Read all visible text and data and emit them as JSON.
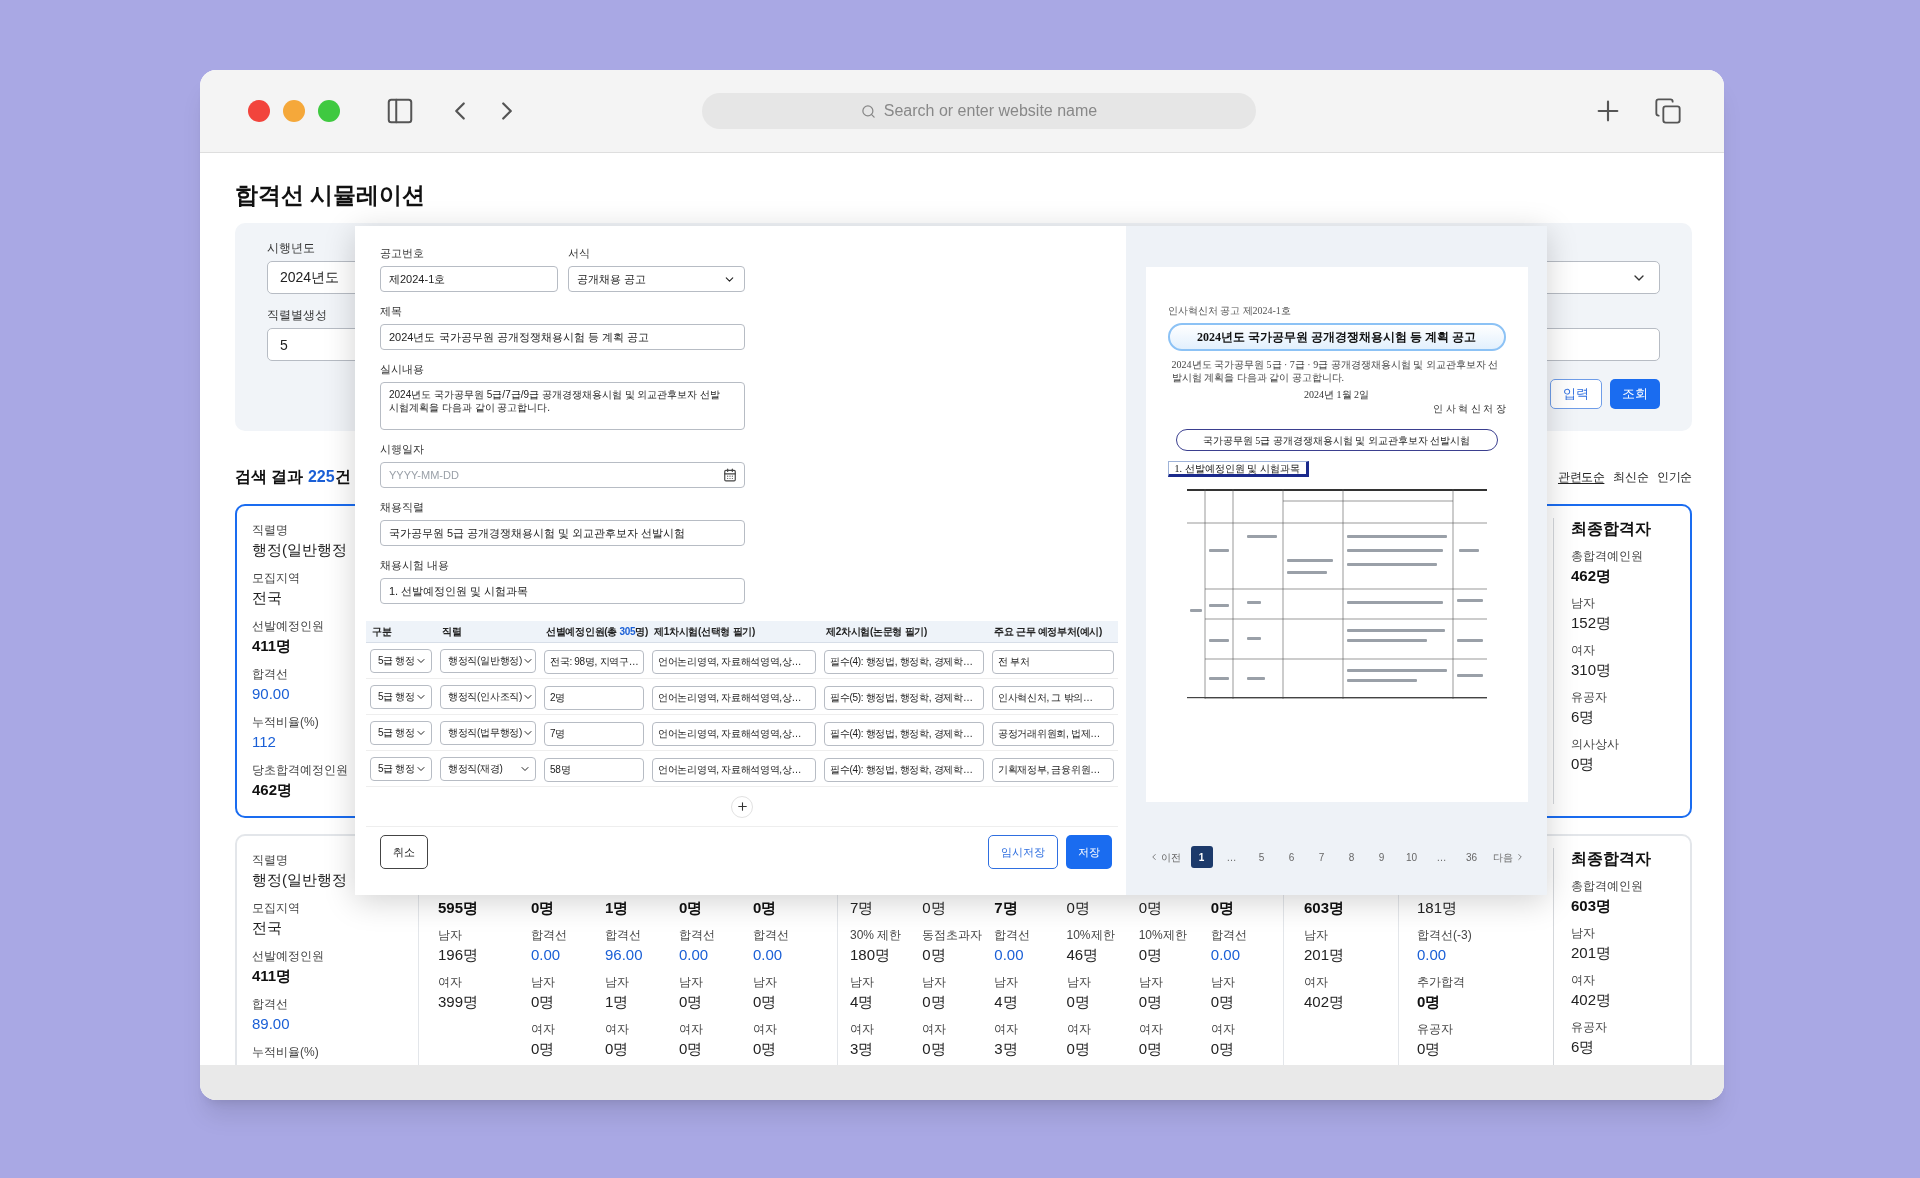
{
  "browser": {
    "address_placeholder": "Search or enter website name"
  },
  "page": {
    "title": "합격선 시뮬레이션"
  },
  "filters": {
    "fields": [
      {
        "label": "시행년도",
        "kind": "select",
        "value": "2024년도"
      },
      {
        "label": "직렬별생성",
        "kind": "input",
        "value": "5"
      }
    ],
    "buttons": [
      {
        "label": "입력",
        "kind": "outline"
      },
      {
        "label": "조회",
        "kind": "primary"
      }
    ]
  },
  "results": {
    "prefix": "검색 결과 ",
    "count": "225",
    "suffix": "건",
    "sort": [
      {
        "label": "관련도순",
        "selected": true
      },
      {
        "label": "최신순",
        "selected": false
      },
      {
        "label": "인기순",
        "selected": false
      }
    ]
  },
  "cards": [
    {
      "selected": true,
      "left": [
        {
          "label": "직렬명",
          "value": "행정(일반행정",
          "kind": "text"
        },
        {
          "label": "모집지역",
          "value": "전국",
          "kind": "text"
        },
        {
          "label": "선발예정인원",
          "value": "411명",
          "kind": "total"
        },
        {
          "label": "합격선",
          "value": "90.00",
          "kind": "score"
        },
        {
          "label": "누적비율(%)",
          "value": "112",
          "kind": "score"
        },
        {
          "label": "당초합격예정인원",
          "value": "462명",
          "kind": "total"
        }
      ],
      "final": {
        "title": "최종합격자",
        "items": [
          {
            "label": "총합격예인원",
            "value": "462명",
            "kind": "total"
          },
          {
            "label": "남자",
            "value": "152명",
            "kind": "text"
          },
          {
            "label": "여자",
            "value": "310명",
            "kind": "text"
          },
          {
            "label": "유공자",
            "value": "6명",
            "kind": "text"
          },
          {
            "label": "의사상사",
            "value": "0명",
            "kind": "text"
          }
        ]
      }
    },
    {
      "selected": false,
      "left": [
        {
          "label": "직렬명",
          "value": "행정(일반행정",
          "kind": "text"
        },
        {
          "label": "모집지역",
          "value": "전국",
          "kind": "text"
        },
        {
          "label": "선발예정인원",
          "value": "411명",
          "kind": "total"
        },
        {
          "label": "합격선",
          "value": "89.00",
          "kind": "score"
        },
        {
          "label": "누적비율(%)"
        }
      ],
      "groups": [
        {
          "columns": [
            [
              {
                "value": "595명",
                "kind": "total"
              },
              {
                "label": "남자",
                "value": "196명",
                "kind": "text"
              },
              {
                "label": "여자",
                "value": "399명",
                "kind": "text"
              }
            ],
            [
              {
                "value": "0명",
                "kind": "total"
              },
              {
                "label": "합격선",
                "value": "0.00",
                "kind": "score"
              },
              {
                "label": "남자",
                "value": "0명",
                "kind": "text"
              },
              {
                "label": "여자",
                "value": "0명",
                "kind": "text"
              }
            ],
            [
              {
                "value": "1명",
                "kind": "total"
              },
              {
                "label": "합격선",
                "value": "96.00",
                "kind": "score"
              },
              {
                "label": "남자",
                "value": "1명",
                "kind": "text"
              },
              {
                "label": "여자",
                "value": "0명",
                "kind": "text"
              }
            ],
            [
              {
                "value": "0명",
                "kind": "total"
              },
              {
                "label": "합격선",
                "value": "0.00",
                "kind": "score"
              },
              {
                "label": "남자",
                "value": "0명",
                "kind": "text"
              },
              {
                "label": "여자",
                "value": "0명",
                "kind": "text"
              }
            ],
            [
              {
                "value": "0명",
                "kind": "total"
              },
              {
                "label": "합격선",
                "value": "0.00",
                "kind": "score"
              },
              {
                "label": "남자",
                "value": "0명",
                "kind": "text"
              },
              {
                "label": "여자",
                "value": "0명",
                "kind": "text"
              }
            ]
          ]
        },
        {
          "columns": [
            [
              {
                "value": "7명",
                "kind": "text"
              },
              {
                "label": "30% 제한",
                "value": "180명",
                "kind": "text"
              },
              {
                "label": "남자",
                "value": "4명",
                "kind": "text"
              },
              {
                "label": "여자",
                "value": "3명",
                "kind": "text"
              }
            ],
            [
              {
                "value": "0명",
                "kind": "text"
              },
              {
                "label": "동점초과자",
                "value": "0명",
                "kind": "text"
              },
              {
                "label": "남자",
                "value": "0명",
                "kind": "text"
              },
              {
                "label": "여자",
                "value": "0명",
                "kind": "text"
              }
            ],
            [
              {
                "value": "7명",
                "kind": "total"
              },
              {
                "label": "합격선",
                "value": "0.00",
                "kind": "score"
              },
              {
                "label": "남자",
                "value": "4명",
                "kind": "text"
              },
              {
                "label": "여자",
                "value": "3명",
                "kind": "text"
              }
            ],
            [
              {
                "value": "0명",
                "kind": "text"
              },
              {
                "label": "10%제한",
                "value": "46명",
                "kind": "text"
              },
              {
                "label": "남자",
                "value": "0명",
                "kind": "text"
              },
              {
                "label": "여자",
                "value": "0명",
                "kind": "text"
              }
            ],
            [
              {
                "value": "0명",
                "kind": "text"
              },
              {
                "label": "10%제한",
                "value": "0명",
                "kind": "text"
              },
              {
                "label": "남자",
                "value": "0명",
                "kind": "text"
              },
              {
                "label": "여자",
                "value": "0명",
                "kind": "text"
              }
            ],
            [
              {
                "value": "0명",
                "kind": "total"
              },
              {
                "label": "합격선",
                "value": "0.00",
                "kind": "score"
              },
              {
                "label": "남자",
                "value": "0명",
                "kind": "text"
              },
              {
                "label": "여자",
                "value": "0명",
                "kind": "text"
              }
            ]
          ]
        },
        {
          "columns": [
            [
              {
                "value": "603명",
                "kind": "total"
              },
              {
                "label": "남자",
                "value": "201명",
                "kind": "text"
              },
              {
                "label": "여자",
                "value": "402명",
                "kind": "text"
              }
            ]
          ]
        },
        {
          "columns": [
            [
              {
                "value": "181명",
                "kind": "text"
              },
              {
                "label": "합격선(-3)",
                "value": "0.00",
                "kind": "score"
              },
              {
                "label": "추가합격",
                "value": "0명",
                "kind": "total"
              },
              {
                "label": "유공자",
                "value": "0명",
                "kind": "text"
              }
            ]
          ]
        }
      ],
      "final": {
        "title": "최종합격자",
        "items": [
          {
            "label": "총합격예인원",
            "value": "603명",
            "kind": "total"
          },
          {
            "label": "남자",
            "value": "201명",
            "kind": "text"
          },
          {
            "label": "여자",
            "value": "402명",
            "kind": "text"
          },
          {
            "label": "유공자",
            "value": "6명",
            "kind": "text"
          }
        ]
      }
    }
  ],
  "modal": {
    "form": [
      [
        {
          "label": "공고번호",
          "kind": "input",
          "value": "제2024-1호"
        },
        {
          "label": "서식",
          "kind": "select",
          "value": "공개채용 공고"
        }
      ],
      [
        {
          "label": "제목",
          "kind": "input",
          "value": "2024년도 국가공무원 공개정쟁채용시험 등 계획 공고"
        }
      ],
      [
        {
          "label": "실시내용",
          "kind": "textarea",
          "value": "2024년도 국가공무원 5급/7급/9급 공개경쟁채용시험 및 외교관후보자 선발\n시험계획을 다음과 같이 공고합니다."
        }
      ],
      [
        {
          "label": "시행일자",
          "kind": "date",
          "placeholder": "YYYY-MM-DD"
        }
      ],
      [
        {
          "label": "채용직렬",
          "kind": "input",
          "value": "국가공무원 5급 공개경쟁채용시험 및 외교관후보자 선발시험"
        }
      ],
      [
        {
          "label": "채용시험 내용",
          "kind": "input",
          "value": "1. 선발예정인원 및 시험과목"
        }
      ]
    ],
    "table": {
      "columns": [
        {
          "label": "구분"
        },
        {
          "label": "직렬"
        },
        {
          "label": "선별예정인원(총 ",
          "count": "305",
          "suffix": "명)"
        },
        {
          "label": "제1차시험(선택형 필기)"
        },
        {
          "label": "제2차시험(논문형 필기)"
        },
        {
          "label": "주요 근무 예정부처(예시)"
        }
      ],
      "rows": [
        [
          {
            "kind": "select",
            "value": "5급 행정"
          },
          {
            "kind": "select",
            "value": "행정직(일반행정)"
          },
          {
            "kind": "input",
            "value": "전국: 98명, 지역구…"
          },
          {
            "kind": "input",
            "value": "언어논리영역, 자료해석영역,상…"
          },
          {
            "kind": "input",
            "value": "필수(4): 행정법, 행정학, 경제학…"
          },
          {
            "kind": "input",
            "value": "전 부처"
          }
        ],
        [
          {
            "kind": "select",
            "value": "5급 행정"
          },
          {
            "kind": "select",
            "value": "행정직(인사조직)"
          },
          {
            "kind": "input",
            "value": "2명"
          },
          {
            "kind": "input",
            "value": "언어논리영역, 자료해석영역,상…"
          },
          {
            "kind": "input",
            "value": "필수(5): 행정법, 행정학, 경제학…"
          },
          {
            "kind": "input",
            "value": "인사혁신처, 그 밖의…"
          }
        ],
        [
          {
            "kind": "select",
            "value": "5급 행정"
          },
          {
            "kind": "select",
            "value": "행정직(법무행정)"
          },
          {
            "kind": "input",
            "value": "7명"
          },
          {
            "kind": "input",
            "value": "언어논리영역, 자료해석영역,상…"
          },
          {
            "kind": "input",
            "value": "필수(4): 행정법, 행정학, 경제학…"
          },
          {
            "kind": "input",
            "value": "공정거래위원회, 법제…"
          }
        ],
        [
          {
            "kind": "select",
            "value": "5급 행정"
          },
          {
            "kind": "select",
            "value": "행정직(재경)"
          },
          {
            "kind": "input",
            "value": "58명"
          },
          {
            "kind": "input",
            "value": "언어논리영역, 자료해석영역,상…"
          },
          {
            "kind": "input",
            "value": "필수(4): 행정법, 행정학, 경제학…"
          },
          {
            "kind": "input",
            "value": "기획재정부, 금융위원…"
          }
        ]
      ]
    },
    "footer": [
      {
        "label": "취소",
        "kind": "cancel"
      },
      {
        "label": "임시저장",
        "kind": "outline"
      },
      {
        "label": "저장",
        "kind": "primary"
      }
    ],
    "document": {
      "notice_no": "인사혁신처 공고 제2024-1호",
      "title": "2024년도 국가공무원 공개경쟁채용시험 등 계획 공고",
      "body": "2024년도 국가공무원 5급 · 7급 · 9급 공개경쟁채용시험 및 외교관후보자 선발시험 계획을 다음과 같이 공고합니다.",
      "date": "2024년 1월 2일",
      "signer": "인 사 혁 신 처 장",
      "subtitle": "국가공무원 5급 공개경쟁채용시험 및 외교관후보자 선발시험",
      "section": "1. 선발예정인원 및 시험과목"
    },
    "pagination": [
      {
        "kind": "prev",
        "label": "이전",
        "selected": false
      },
      {
        "kind": "page",
        "label": "1",
        "selected": true
      },
      {
        "kind": "ellipsis",
        "label": "…",
        "selected": false
      },
      {
        "kind": "page",
        "label": "5",
        "selected": false
      },
      {
        "kind": "page",
        "label": "6",
        "selected": false
      },
      {
        "kind": "page",
        "label": "7",
        "selected": false
      },
      {
        "kind": "page",
        "label": "8",
        "selected": false
      },
      {
        "kind": "page",
        "label": "9",
        "selected": false
      },
      {
        "kind": "page",
        "label": "10",
        "selected": false
      },
      {
        "kind": "ellipsis",
        "label": "…",
        "selected": false
      },
      {
        "kind": "page",
        "label": "36",
        "selected": false
      },
      {
        "kind": "next",
        "label": "다음",
        "selected": false
      }
    ]
  }
}
